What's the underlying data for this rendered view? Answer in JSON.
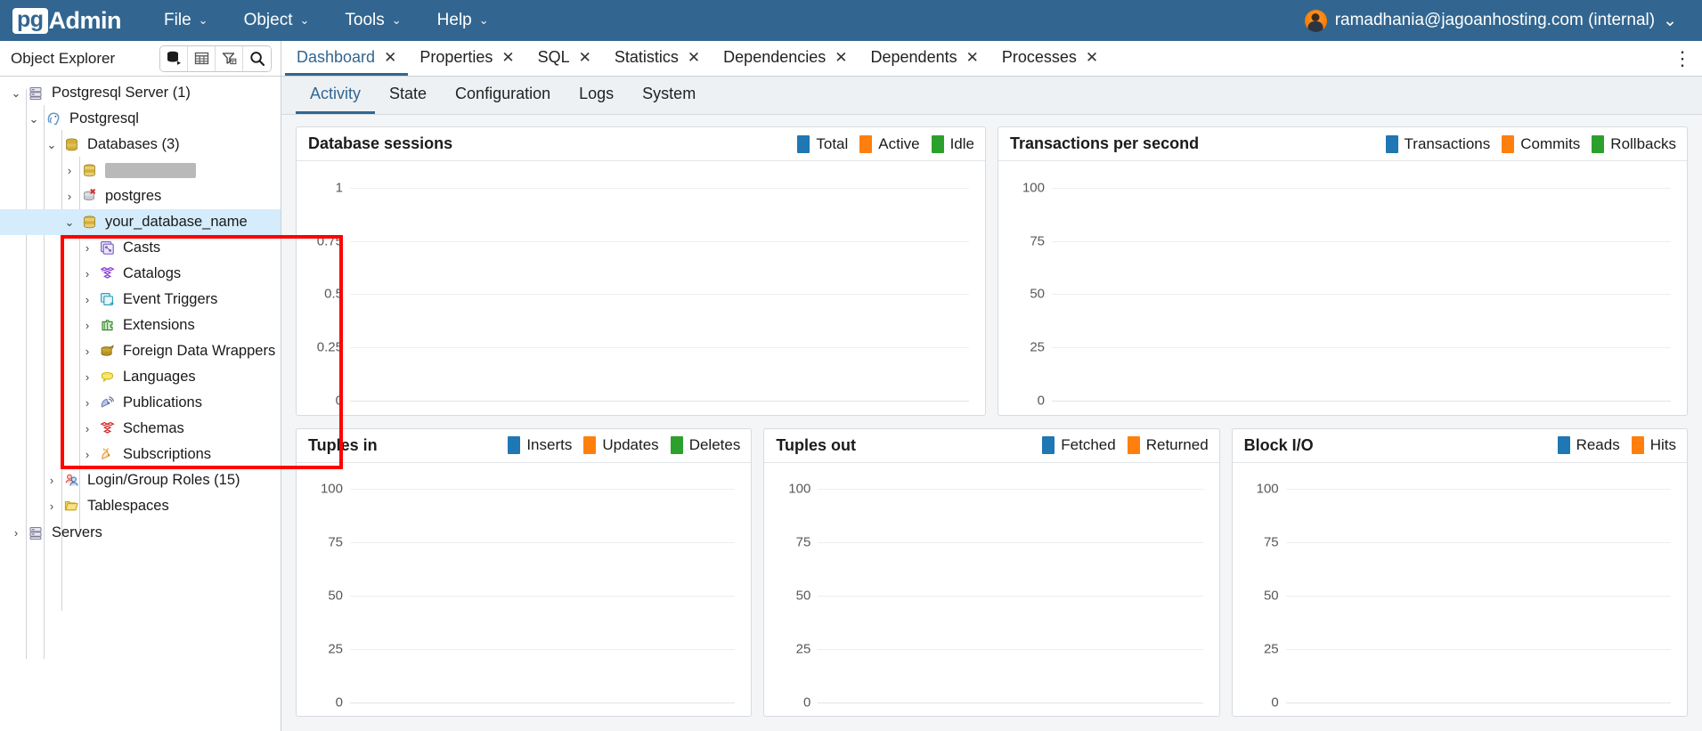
{
  "app": {
    "brand_pg": "pg",
    "brand_admin": "Admin"
  },
  "menubar": {
    "items": [
      {
        "label": "File",
        "caret": "⌄"
      },
      {
        "label": "Object",
        "caret": "⌄"
      },
      {
        "label": "Tools",
        "caret": "⌄"
      },
      {
        "label": "Help",
        "caret": "⌄"
      }
    ],
    "user": {
      "name": "ramadhania@jagoanhosting.com (internal)",
      "caret": "⌄",
      "avatar_icon": "user-avatar"
    }
  },
  "object_explorer": {
    "title": "Object Explorer",
    "tools": [
      {
        "name": "object-browser-icon"
      },
      {
        "name": "grid-table-icon"
      },
      {
        "name": "filter-icon"
      },
      {
        "name": "search-icon"
      }
    ]
  },
  "tabs": {
    "items": [
      {
        "label": "Dashboard",
        "active": true,
        "close": "✕"
      },
      {
        "label": "Properties",
        "active": false,
        "close": "✕"
      },
      {
        "label": "SQL",
        "active": false,
        "close": "✕"
      },
      {
        "label": "Statistics",
        "active": false,
        "close": "✕"
      },
      {
        "label": "Dependencies",
        "active": false,
        "close": "✕"
      },
      {
        "label": "Dependents",
        "active": false,
        "close": "✕"
      },
      {
        "label": "Processes",
        "active": false,
        "close": "✕"
      }
    ],
    "kebab": "⋮"
  },
  "subtabs": {
    "items": [
      {
        "label": "Activity",
        "active": true
      },
      {
        "label": "State",
        "active": false
      },
      {
        "label": "Configuration",
        "active": false
      },
      {
        "label": "Logs",
        "active": false
      },
      {
        "label": "System",
        "active": false
      }
    ]
  },
  "tree": {
    "nodes": [
      {
        "label": "Postgresql Server (1)",
        "depth": 0,
        "arrow": "⌄",
        "expanded": true,
        "icon": "server-icon",
        "selected": false,
        "redacted": false
      },
      {
        "label": "Postgresql",
        "depth": 1,
        "arrow": "⌄",
        "expanded": true,
        "icon": "postgres-elephant-icon",
        "selected": false,
        "redacted": false
      },
      {
        "label": "Databases (3)",
        "depth": 2,
        "arrow": "⌄",
        "expanded": true,
        "icon": "databases-icon",
        "selected": false,
        "redacted": false
      },
      {
        "label": "",
        "depth": 3,
        "arrow": "›",
        "expanded": false,
        "icon": "database-icon",
        "selected": false,
        "redacted": true
      },
      {
        "label": "postgres",
        "depth": 3,
        "arrow": "›",
        "expanded": false,
        "icon": "database-disconnected-icon",
        "selected": false,
        "redacted": false
      },
      {
        "label": "your_database_name",
        "depth": 3,
        "arrow": "⌄",
        "expanded": true,
        "icon": "database-icon",
        "selected": true,
        "redacted": false
      },
      {
        "label": "Casts",
        "depth": 4,
        "arrow": "›",
        "expanded": false,
        "icon": "casts-icon",
        "selected": false,
        "redacted": false
      },
      {
        "label": "Catalogs",
        "depth": 4,
        "arrow": "›",
        "expanded": false,
        "icon": "catalogs-icon",
        "selected": false,
        "redacted": false
      },
      {
        "label": "Event Triggers",
        "depth": 4,
        "arrow": "›",
        "expanded": false,
        "icon": "event-triggers-icon",
        "selected": false,
        "redacted": false
      },
      {
        "label": "Extensions",
        "depth": 4,
        "arrow": "›",
        "expanded": false,
        "icon": "extensions-icon",
        "selected": false,
        "redacted": false
      },
      {
        "label": "Foreign Data Wrappers",
        "depth": 4,
        "arrow": "›",
        "expanded": false,
        "icon": "foreign-data-wrappers-icon",
        "selected": false,
        "redacted": false
      },
      {
        "label": "Languages",
        "depth": 4,
        "arrow": "›",
        "expanded": false,
        "icon": "languages-icon",
        "selected": false,
        "redacted": false
      },
      {
        "label": "Publications",
        "depth": 4,
        "arrow": "›",
        "expanded": false,
        "icon": "publications-icon",
        "selected": false,
        "redacted": false
      },
      {
        "label": "Schemas",
        "depth": 4,
        "arrow": "›",
        "expanded": false,
        "icon": "schemas-icon",
        "selected": false,
        "redacted": false
      },
      {
        "label": "Subscriptions",
        "depth": 4,
        "arrow": "›",
        "expanded": false,
        "icon": "subscriptions-icon",
        "selected": false,
        "redacted": false
      },
      {
        "label": "Login/Group Roles (15)",
        "depth": 3,
        "arrow": "›",
        "expanded": false,
        "icon": "login-group-roles-icon",
        "selected": false,
        "redacted": false
      },
      {
        "label": "Tablespaces",
        "depth": 3,
        "arrow": "›",
        "expanded": false,
        "icon": "tablespaces-icon",
        "selected": false,
        "redacted": false
      },
      {
        "label": "Servers",
        "depth": 0,
        "arrow": "›",
        "expanded": false,
        "icon": "server-icon",
        "selected": false,
        "redacted": false
      }
    ]
  },
  "colors": {
    "brand_blue": "#326690",
    "series_blue": "#1f77b4",
    "series_orange": "#ff7f0e",
    "series_green": "#2ca02c",
    "annotation_red": "#ff0000",
    "selection_blue": "#d4ecfb"
  },
  "chart_data": [
    {
      "type": "line",
      "title": "Database sessions",
      "xlabel": "",
      "ylabel": "",
      "ylim": [
        0,
        1
      ],
      "yticks": [
        "1",
        "0.75",
        "0.5",
        "0.25",
        "0"
      ],
      "grid": true,
      "legend_position": "top-right",
      "series": [
        {
          "name": "Total",
          "color": "#1f77b4",
          "values": []
        },
        {
          "name": "Active",
          "color": "#ff7f0e",
          "values": []
        },
        {
          "name": "Idle",
          "color": "#2ca02c",
          "values": []
        }
      ]
    },
    {
      "type": "line",
      "title": "Transactions per second",
      "xlabel": "",
      "ylabel": "",
      "ylim": [
        0,
        100
      ],
      "yticks": [
        "100",
        "75",
        "50",
        "25",
        "0"
      ],
      "grid": true,
      "legend_position": "top-right",
      "series": [
        {
          "name": "Transactions",
          "color": "#1f77b4",
          "values": []
        },
        {
          "name": "Commits",
          "color": "#ff7f0e",
          "values": []
        },
        {
          "name": "Rollbacks",
          "color": "#2ca02c",
          "values": []
        }
      ]
    },
    {
      "type": "line",
      "title": "Tuples in",
      "xlabel": "",
      "ylabel": "",
      "ylim": [
        0,
        100
      ],
      "yticks": [
        "100",
        "75",
        "50",
        "25",
        "0"
      ],
      "grid": true,
      "legend_position": "top-right",
      "series": [
        {
          "name": "Inserts",
          "color": "#1f77b4",
          "values": []
        },
        {
          "name": "Updates",
          "color": "#ff7f0e",
          "values": []
        },
        {
          "name": "Deletes",
          "color": "#2ca02c",
          "values": []
        }
      ]
    },
    {
      "type": "line",
      "title": "Tuples out",
      "xlabel": "",
      "ylabel": "",
      "ylim": [
        0,
        100
      ],
      "yticks": [
        "100",
        "75",
        "50",
        "25",
        "0"
      ],
      "grid": true,
      "legend_position": "top-right",
      "series": [
        {
          "name": "Fetched",
          "color": "#1f77b4",
          "values": []
        },
        {
          "name": "Returned",
          "color": "#ff7f0e",
          "values": []
        }
      ]
    },
    {
      "type": "line",
      "title": "Block I/O",
      "xlabel": "",
      "ylabel": "",
      "ylim": [
        0,
        100
      ],
      "yticks": [
        "100",
        "75",
        "50",
        "25",
        "0"
      ],
      "grid": true,
      "legend_position": "top-right",
      "series": [
        {
          "name": "Reads",
          "color": "#1f77b4",
          "values": []
        },
        {
          "name": "Hits",
          "color": "#ff7f0e",
          "values": []
        }
      ]
    }
  ]
}
